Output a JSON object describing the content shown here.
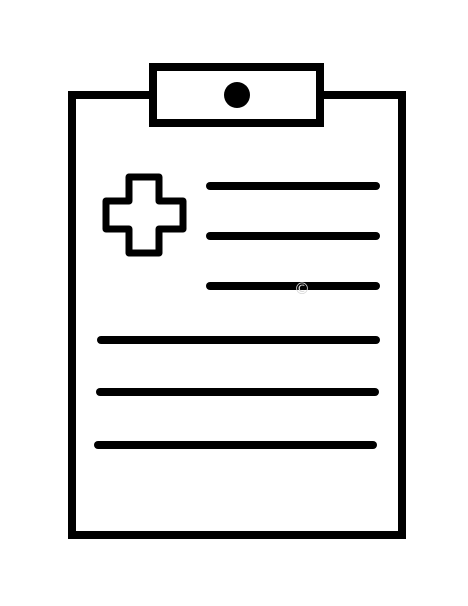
{
  "icon": {
    "name": "medical-clipboard-icon",
    "stroke_color": "#000000",
    "fill_color": "#ffffff",
    "background_color": "#ffffff",
    "watermark_color": "#d9d9d9",
    "watermark_glyph": "©"
  }
}
